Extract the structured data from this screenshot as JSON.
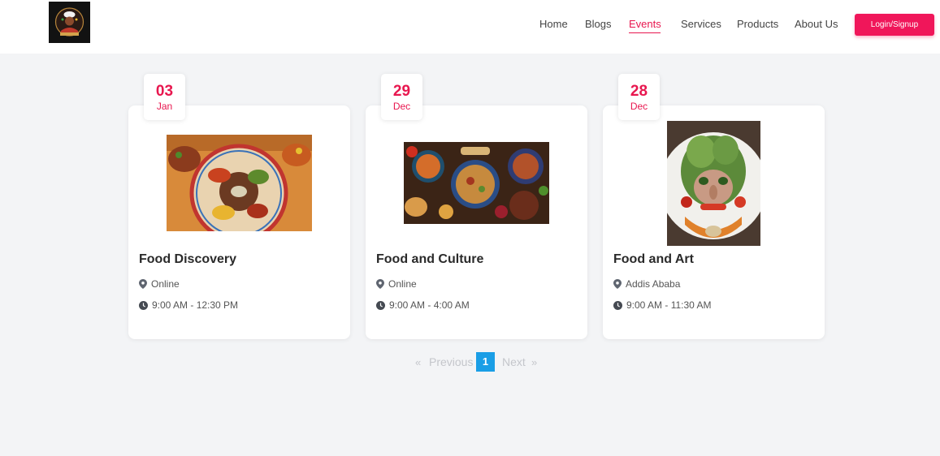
{
  "nav": {
    "items": [
      {
        "label": "Home"
      },
      {
        "label": "Blogs"
      },
      {
        "label": "Events"
      },
      {
        "label": "Services"
      },
      {
        "label": "Products"
      },
      {
        "label": "About Us"
      }
    ],
    "active": "Events",
    "login_label": "Login/Signup",
    "accent_color": "#e8174f"
  },
  "events": [
    {
      "day": "03",
      "month": "Jan",
      "title": "Food Discovery",
      "location": "Online",
      "time": "9:00 AM - 12:30 PM",
      "image": "ethiopian-platter-photo"
    },
    {
      "day": "29",
      "month": "Dec",
      "title": "Food and Culture",
      "location": "Online",
      "time": "9:00 AM - 4:00 AM",
      "image": "food-spread-photo"
    },
    {
      "day": "28",
      "month": "Dec",
      "title": "Food and Art",
      "location": "Addis Ababa",
      "time": "9:00 AM - 11:30 AM",
      "image": "vegetable-face-art-photo"
    }
  ],
  "pagination": {
    "first_symbol": "«",
    "previous_label": "Previous",
    "current_page": "1",
    "next_label": "Next",
    "last_symbol": "»",
    "current_color": "#1a9ee6"
  }
}
